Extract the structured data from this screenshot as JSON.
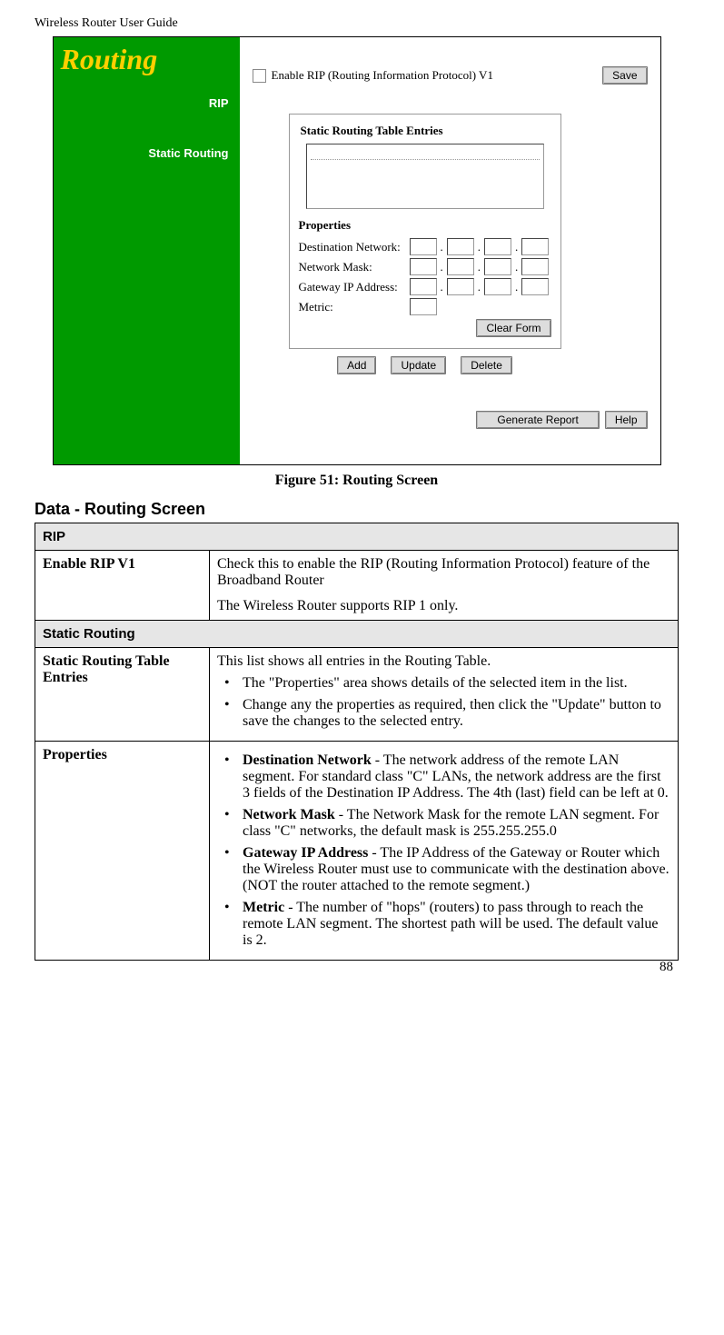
{
  "header": "Wireless Router User Guide",
  "pageNumber": "88",
  "screenshot": {
    "title": "Routing",
    "sidebar": {
      "rip": "RIP",
      "static": "Static Routing"
    },
    "ripRow": {
      "checkboxLabel": "Enable RIP (Routing Information Protocol) V1",
      "save": "Save"
    },
    "fieldset1Legend": "Static Routing Table Entries",
    "propsLegend": "Properties",
    "fields": {
      "dest": "Destination Network:",
      "mask": "Network Mask:",
      "gw": "Gateway IP Address:",
      "metric": "Metric:"
    },
    "clearForm": "Clear Form",
    "buttons": {
      "add": "Add",
      "update": "Update",
      "delete": "Delete"
    },
    "footer": {
      "report": "Generate Report",
      "help": "Help"
    }
  },
  "caption": "Figure 51: Routing Screen",
  "sectionTitle": "Data - Routing Screen",
  "table": {
    "ripHeader": "RIP",
    "enableRip": {
      "label": "Enable RIP V1",
      "p1": "Check this to enable the RIP (Routing Information Protocol) feature of the Broadband Router",
      "p2": "The Wireless Router supports RIP 1 only."
    },
    "staticHeader": "Static Routing",
    "entries": {
      "label": "Static Routing Table Entries",
      "p1": "This list shows all entries in the Routing Table.",
      "b1": "The \"Properties\" area shows details of the selected item in the list.",
      "b2": "Change any the properties as required, then click the \"Update\" button to save the changes to the selected entry."
    },
    "props": {
      "label": "Properties",
      "b1b": "Destination Network",
      "b1": " - The network address of the remote LAN segment. For standard class \"C\" LANs, the network address are the first 3 fields of the Destination IP Address. The 4th (last) field can be left at 0.",
      "b2b": "Network Mask",
      "b2": " - The Network Mask for the remote LAN segment. For class \"C\" networks, the default mask is 255.255.255.0",
      "b3b": "Gateway IP Address",
      "b3": " - The IP Address of the Gateway or Router which the Wireless Router must use to communicate with the destination above. (NOT the router attached to the remote segment.)",
      "b4b": "Metric",
      "b4": " - The number of \"hops\" (routers) to pass through to reach the remote LAN segment. The shortest path will be used. The default value is 2."
    }
  }
}
